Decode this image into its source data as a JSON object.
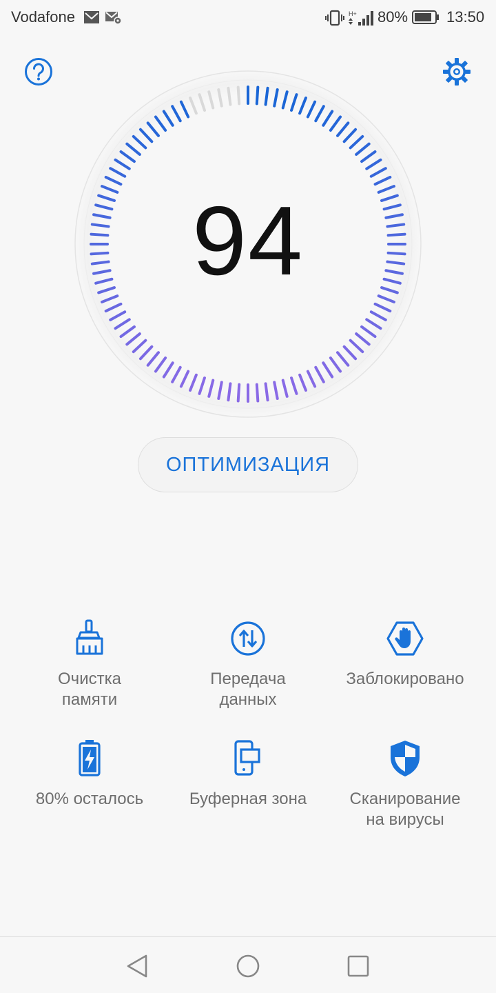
{
  "status_bar": {
    "carrier": "Vodafone",
    "battery_percent": "80%",
    "time": "13:50"
  },
  "header": {
    "help_icon": "help-circle-icon",
    "settings_icon": "gear-icon"
  },
  "dial": {
    "score": "94",
    "tick_count": 100,
    "filled_fraction": 0.94,
    "color_top": "#1a66d6",
    "color_bottom": "#8a6ae6",
    "color_empty": "#d9d9d9"
  },
  "optimize_label": "ОПТИМИЗАЦИЯ",
  "tiles": [
    {
      "label": "Очистка\nпамяти",
      "icon": "broom-icon"
    },
    {
      "label": "Передача\nданных",
      "icon": "data-transfer-icon"
    },
    {
      "label": "Заблокировано",
      "icon": "blocked-hand-icon"
    },
    {
      "label": "80% осталось",
      "icon": "battery-icon"
    },
    {
      "label": "Буферная зона",
      "icon": "buffer-zone-icon"
    },
    {
      "label": "Сканирование\nна вирусы",
      "icon": "shield-icon"
    }
  ],
  "colors": {
    "accent": "#1a73d9"
  }
}
